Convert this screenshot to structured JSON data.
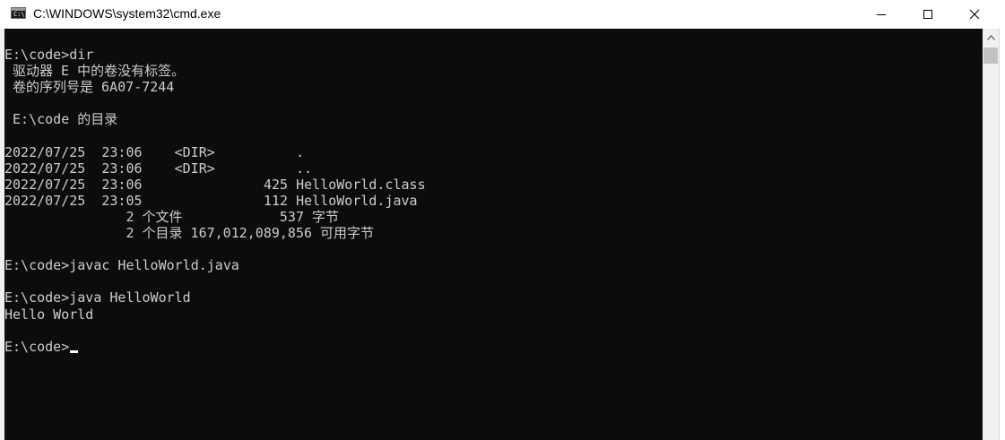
{
  "window": {
    "title": "C:\\WINDOWS\\system32\\cmd.exe",
    "app_icon_glyph": "C:\\",
    "minimize_label": "–",
    "maximize_label": "□",
    "close_label": "✕"
  },
  "console": {
    "lines": [
      "E:\\code>dir",
      " 驱动器 E 中的卷没有标签。",
      " 卷的序列号是 6A07-7244",
      "",
      " E:\\code 的目录",
      "",
      "2022/07/25  23:06    <DIR>          .",
      "2022/07/25  23:06    <DIR>          ..",
      "2022/07/25  23:06               425 HelloWorld.class",
      "2022/07/25  23:05               112 HelloWorld.java",
      "               2 个文件            537 字节",
      "               2 个目录 167,012,089,856 可用字节",
      "",
      "E:\\code>javac HelloWorld.java",
      "",
      "E:\\code>java HelloWorld",
      "Hello World",
      ""
    ],
    "prompt": "E:\\code>"
  },
  "scrollbar": {
    "up_arrow": "^"
  }
}
